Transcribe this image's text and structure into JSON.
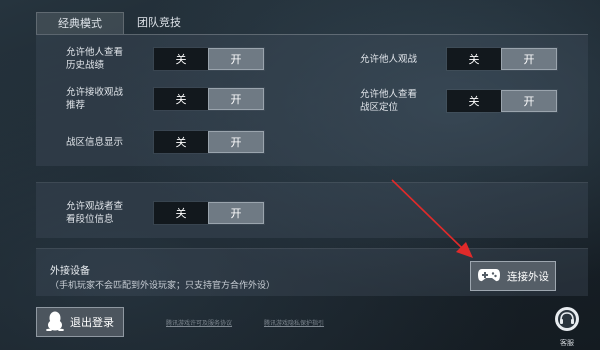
{
  "tabs": [
    {
      "label": "经典模式"
    },
    {
      "label": "团队竞技"
    }
  ],
  "settings": {
    "history": {
      "label": "允许他人查看\n历史战绩",
      "off": "关",
      "on": "开"
    },
    "spectate": {
      "label": "允许他人观战",
      "off": "关",
      "on": "开"
    },
    "recommend": {
      "label": "允许接收观战\n推荐",
      "off": "关",
      "on": "开"
    },
    "location": {
      "label": "允许他人查看\n战区定位",
      "off": "关",
      "on": "开"
    },
    "region_info": {
      "label": "战区信息显示",
      "off": "关",
      "on": "开"
    },
    "rank_view": {
      "label": "允许观战者查\n看段位信息",
      "off": "关",
      "on": "开"
    }
  },
  "external": {
    "title": "外接设备",
    "note": "（手机玩家不会匹配到外设玩家；只支持官方合作外设）",
    "connect_label": "连接外设"
  },
  "footer": {
    "logout_label": "退出登录",
    "link_terms": "腾讯游戏许可及服务协议",
    "link_privacy": "腾讯游戏隐私保护指引",
    "support_label": "客服"
  },
  "colors": {
    "accent_arrow": "#e02a2a",
    "toggle_on": "#6f7a84",
    "toggle_off": "#12181d"
  }
}
